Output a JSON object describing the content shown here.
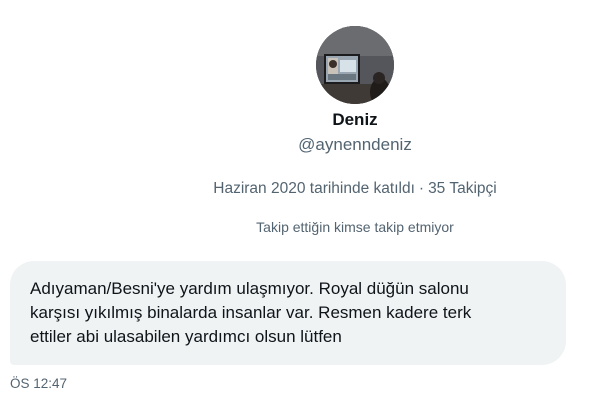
{
  "profile": {
    "display_name": "Deniz",
    "handle": "@aynenndeniz",
    "joined": "Haziran 2020 tarihinde katıldı",
    "separator": "·",
    "followers": "35 Takipçi",
    "mutual_info": "Takip ettiğin kimse takip etmiyor",
    "avatar_description_icon": "avatar-photo"
  },
  "message": {
    "text": "Adıyaman/Besni'ye yardım ulaşmıyor. Royal düğün salonu karşısı yıkılmış binalarda insanlar var. Resmen kadere terk ettiler abi ulasabilen yardımcı olsun lütfen",
    "timestamp": "ÖS 12:47"
  },
  "colors": {
    "bubble_bg": "#eff3f4",
    "primary_text": "#0f1419",
    "secondary_text": "#536471"
  }
}
